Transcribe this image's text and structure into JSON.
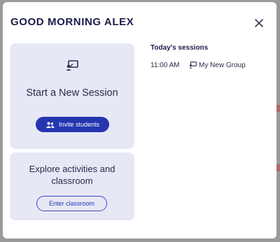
{
  "modal": {
    "title": "GOOD MORNING ALEX",
    "close_icon": "close-icon"
  },
  "new_session_card": {
    "icon": "session-screen-icon",
    "title": "Start a New Session",
    "invite_button": {
      "icon": "people-icon",
      "label": "Invite students"
    }
  },
  "explore_card": {
    "title": "Explore activities and classroom",
    "enter_button_label": "Enter classroom"
  },
  "today": {
    "heading": "Today's sessions",
    "sessions": [
      {
        "time": "11:00 AM",
        "icon": "session-screen-icon",
        "name": "My New Group"
      }
    ]
  },
  "colors": {
    "primary": "#2536b0",
    "card_bg": "#e7e8f6",
    "text_dark": "#1c1d4a"
  }
}
